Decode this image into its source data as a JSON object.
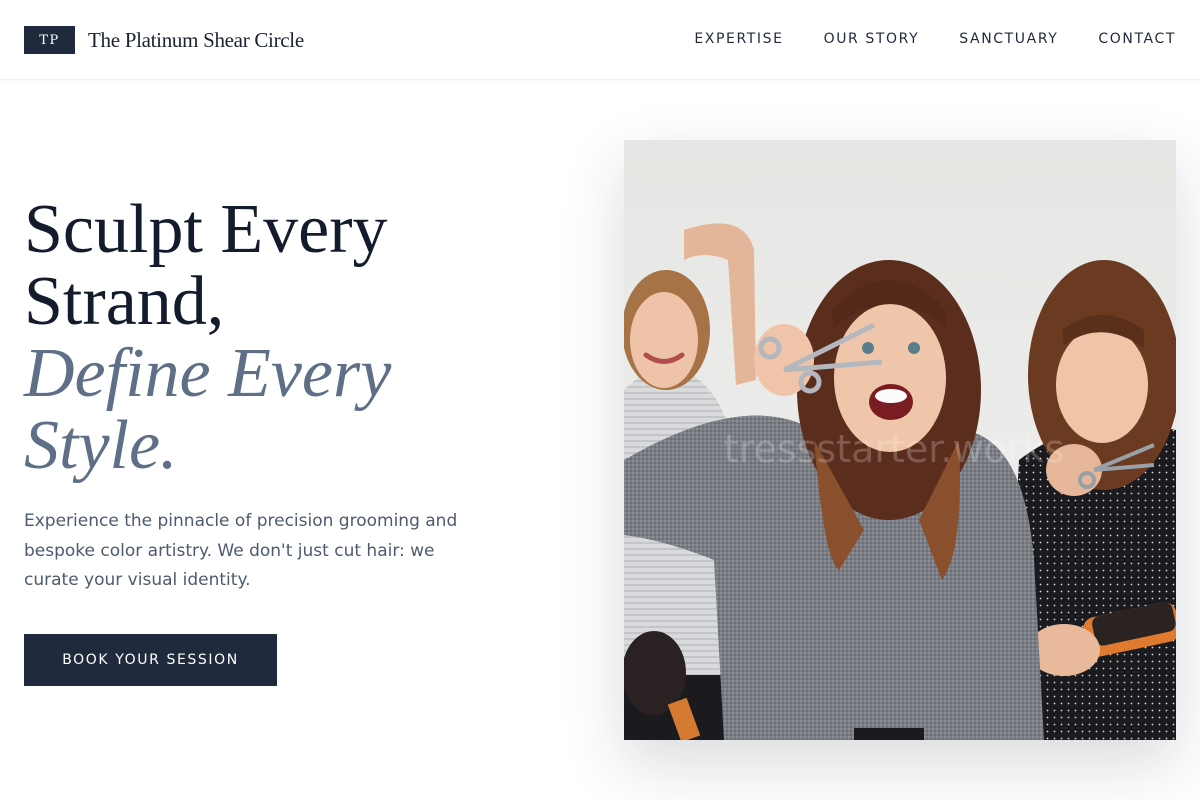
{
  "header": {
    "logo_initials": "TP",
    "brand_name": "The Platinum Shear Circle",
    "nav": [
      {
        "label": "EXPERTISE"
      },
      {
        "label": "OUR STORY"
      },
      {
        "label": "SANCTUARY"
      },
      {
        "label": "CONTACT"
      }
    ]
  },
  "hero": {
    "headline_line1": "Sculpt Every",
    "headline_line2": "Strand,",
    "headline_accent_line1": "Define Every",
    "headline_accent_line2": "Style.",
    "lead": "Experience the pinnacle of precision grooming and bespoke color artistry. We don't just cut hair: we curate your visual identity.",
    "cta_label": "BOOK YOUR SESSION",
    "image_watermark": "tressstarter.works"
  },
  "colors": {
    "navy": "#1f2a3d",
    "accent_slate": "#5e6f87",
    "body_text": "#4d5a70",
    "background": "#ffffff"
  }
}
